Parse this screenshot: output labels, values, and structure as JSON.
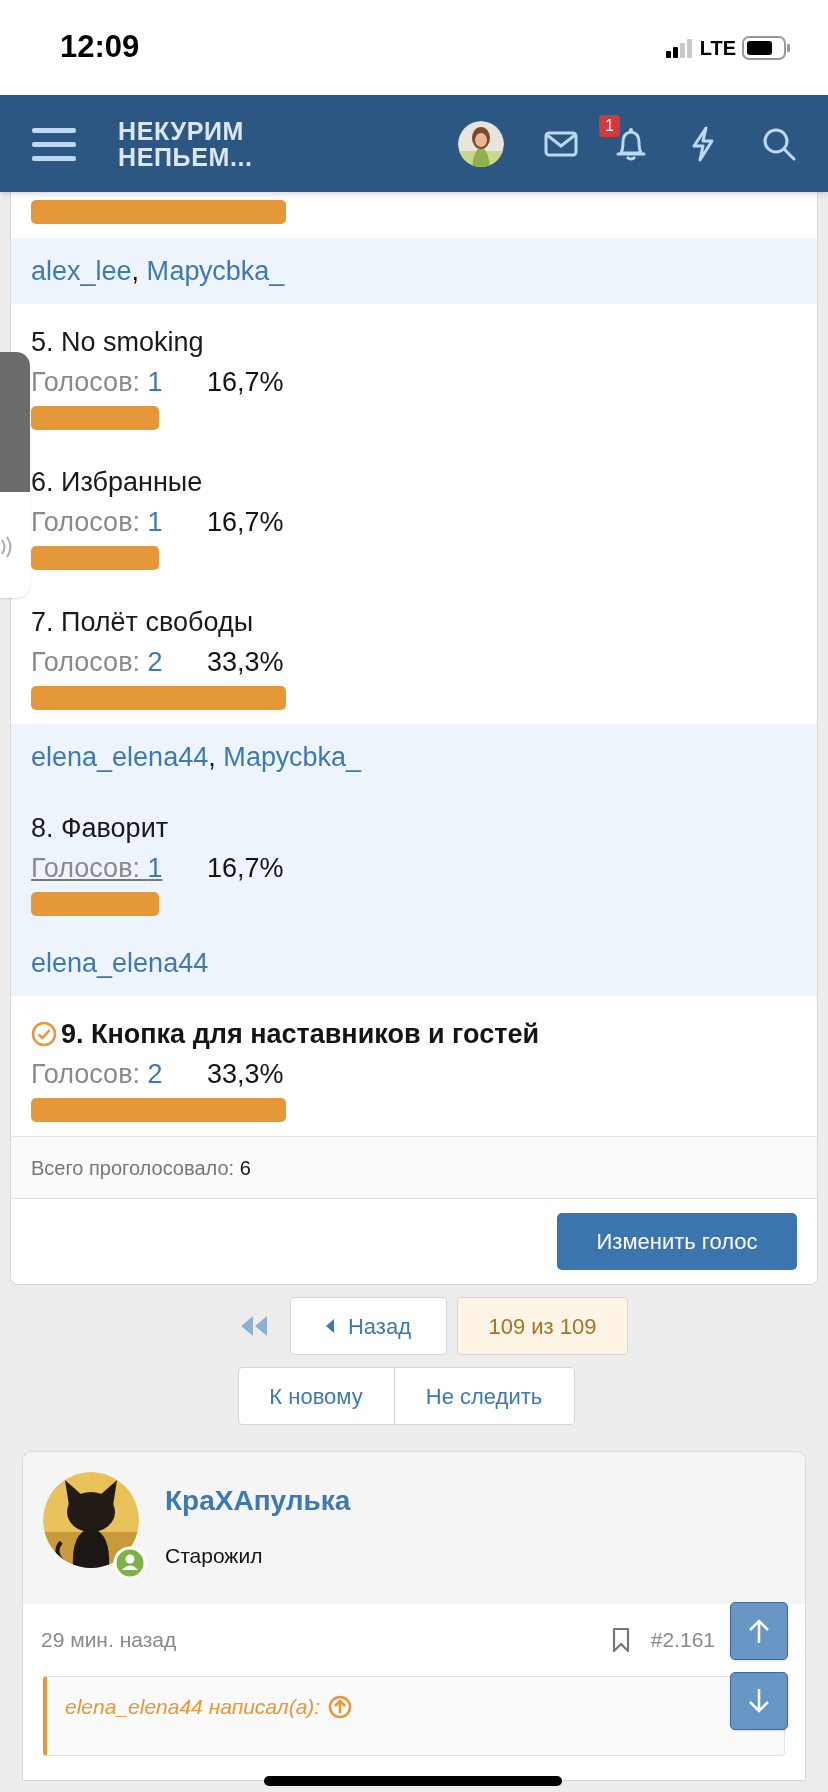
{
  "status_bar": {
    "time": "12:09",
    "network": "LTE"
  },
  "header": {
    "logo_lines": [
      "НЕКУРИМ",
      "НЕПЬЕМ..."
    ],
    "notification_count": "1"
  },
  "poll": {
    "voters_separator": ", ",
    "options": [
      {
        "kind": "partial",
        "voters": [
          "alex_lee",
          "Марусbka_"
        ]
      },
      {
        "kind": "full",
        "title": "5. No smoking",
        "votes_label": "Голосов:",
        "votes": "1",
        "percent": "16,7%",
        "highlighted": false,
        "voted": false
      },
      {
        "kind": "full",
        "title": "6. Избранные",
        "votes_label": "Голосов:",
        "votes": "1",
        "percent": "16,7%",
        "highlighted": false,
        "voted": false
      },
      {
        "kind": "full",
        "title": "7. Полёт свободы",
        "votes_label": "Голосов:",
        "votes": "2",
        "percent": "33,3%",
        "highlighted": false,
        "voted": false,
        "voters": [
          "elena_elena44",
          "Марусbka_"
        ]
      },
      {
        "kind": "full",
        "title": "8. Фаворит",
        "votes_label": "Голосов:",
        "votes": "1",
        "percent": "16,7%",
        "highlighted": true,
        "voted": false,
        "voters": [
          "elena_elena44"
        ]
      },
      {
        "kind": "full",
        "title": "9. Кнопка для наставников и гостей",
        "votes_label": "Голосов:",
        "votes": "2",
        "percent": "33,3%",
        "highlighted": false,
        "voted": true
      }
    ],
    "total_label": "Всего проголосовало:",
    "total": "6",
    "change_button": "Изменить голос"
  },
  "pagination": {
    "back": "Назад",
    "page": "109 из 109",
    "new": "К новому",
    "unwatch": "Не следить"
  },
  "post": {
    "author": "КраХАпулька",
    "rank": "Старожил",
    "time": "29 мин. назад",
    "number": "#2.161",
    "quote_author": "elena_elena44 написал(а):"
  }
}
